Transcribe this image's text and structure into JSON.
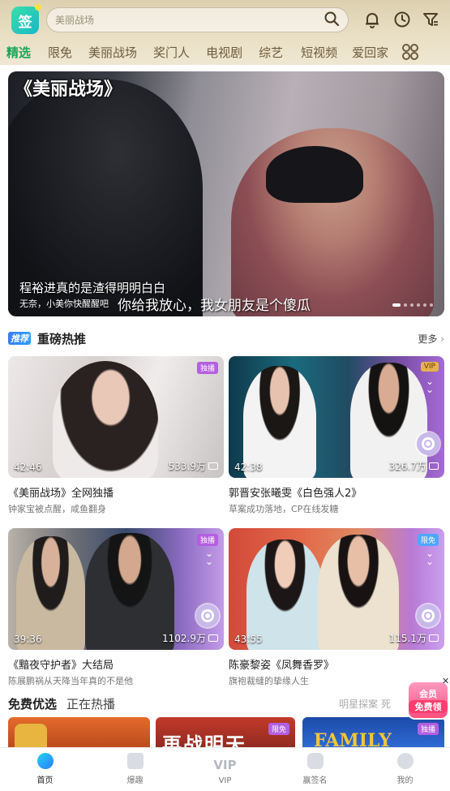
{
  "header": {
    "logo_text": "签",
    "search_placeholder": "美丽战场",
    "icons": [
      "bell-icon",
      "history-icon",
      "filter-icon"
    ]
  },
  "tabs": [
    {
      "label": "精选",
      "active": true
    },
    {
      "label": "限免"
    },
    {
      "label": "美丽战场"
    },
    {
      "label": "奖门人"
    },
    {
      "label": "电视剧"
    },
    {
      "label": "综艺"
    },
    {
      "label": "短视频"
    },
    {
      "label": "爱回家"
    }
  ],
  "banner": {
    "title": "《美丽战场》",
    "caption": "程裕进真的是渣得明明白白",
    "sub_caption": "无奈，小美你快醒醒吧",
    "subtitle": "你给我放心，我女朋友是个傻瓜"
  },
  "section1": {
    "badge": "推荐",
    "title": "重磅热推",
    "more": "更多"
  },
  "cards": [
    {
      "duration": "42:46",
      "plays": "533.9万",
      "tag": "独播",
      "title": "《美丽战场》全网独播",
      "sub": "钟家宝被点醒，咸鱼翻身"
    },
    {
      "duration": "42:38",
      "plays": "326.7万",
      "tag": "VIP",
      "title": "郭晋安张曦雯《白色强人2》",
      "sub": "草案成功落地，CP在线发糖"
    },
    {
      "duration": "39:36",
      "plays": "1102.9万",
      "tag": "独播",
      "title": "《黯夜守护者》大结局",
      "sub": "陈展鹏祸从天降当年真的不是他"
    },
    {
      "duration": "43:55",
      "plays": "115.1万",
      "tag": "限免",
      "title": "陈豪黎姿《凤舞香罗》",
      "sub": "旗袍裁缝的挚缘人生"
    }
  ],
  "section2": {
    "title1": "免费优选",
    "title2": "正在热播",
    "hint": "明星探案 死"
  },
  "strip": {
    "tag2": "限免",
    "tag3": "独播",
    "text2": "再战明天",
    "text3": "FAMILY"
  },
  "float_badge": {
    "line1": "会员",
    "line2": "免费领"
  },
  "bottom_nav": [
    {
      "label": "首页",
      "active": true
    },
    {
      "label": "爆趣"
    },
    {
      "label": "VIP"
    },
    {
      "label": "赢签名"
    },
    {
      "label": "我的"
    }
  ],
  "colors": {
    "accent": "#18a75a",
    "tab_text": "#6d5c3e"
  }
}
